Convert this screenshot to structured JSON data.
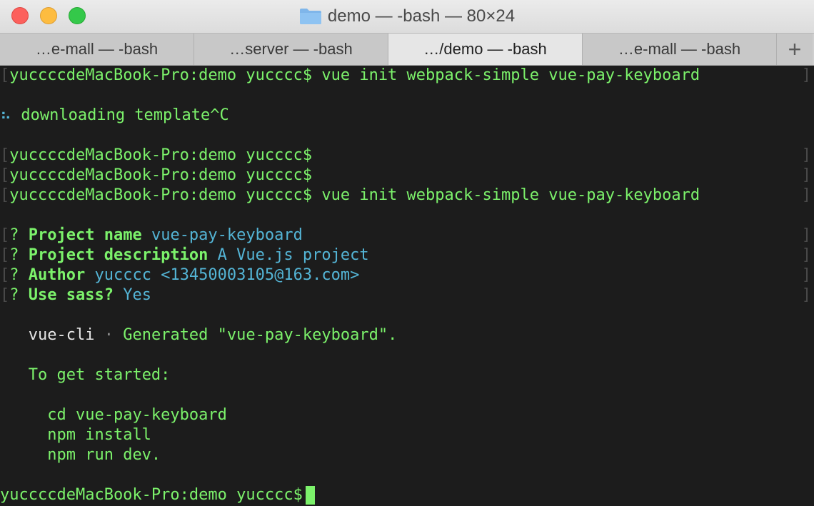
{
  "window": {
    "title": "demo — -bash — 80×24"
  },
  "tabs": [
    {
      "label": "…e-mall — -bash",
      "active": false
    },
    {
      "label": "…server — -bash",
      "active": false
    },
    {
      "label": "…/demo — -bash",
      "active": true
    },
    {
      "label": "…e-mall — -bash",
      "active": false
    }
  ],
  "tab_add_label": "+",
  "terminal": {
    "prompt": "yuccccdeMacBook-Pro:demo yucccc$",
    "cmd1": "vue init webpack-simple vue-pay-keyboard",
    "spinner": "⠦",
    "downloading": "downloading template^C",
    "cmd2": "vue init webpack-simple vue-pay-keyboard",
    "q_mark": "?",
    "q1_label": "Project name",
    "q1_value": "vue-pay-keyboard",
    "q2_label": "Project description",
    "q2_value": "A Vue.js project",
    "q3_label": "Author",
    "q3_value": "yucccc <13450003105@163.com>",
    "q4_label": "Use sass?",
    "q4_value": "Yes",
    "vue_cli": "vue-cli",
    "dot": "·",
    "generated": "Generated \"vue-pay-keyboard\".",
    "get_started": "To get started:",
    "step1": "cd vue-pay-keyboard",
    "step2": "npm install",
    "step3": "npm run dev.",
    "bracket_left": "[",
    "bracket_right": "]"
  },
  "colors": {
    "green": "#7cf26b",
    "cyan": "#54b5d6",
    "background": "#1c1c1c"
  }
}
